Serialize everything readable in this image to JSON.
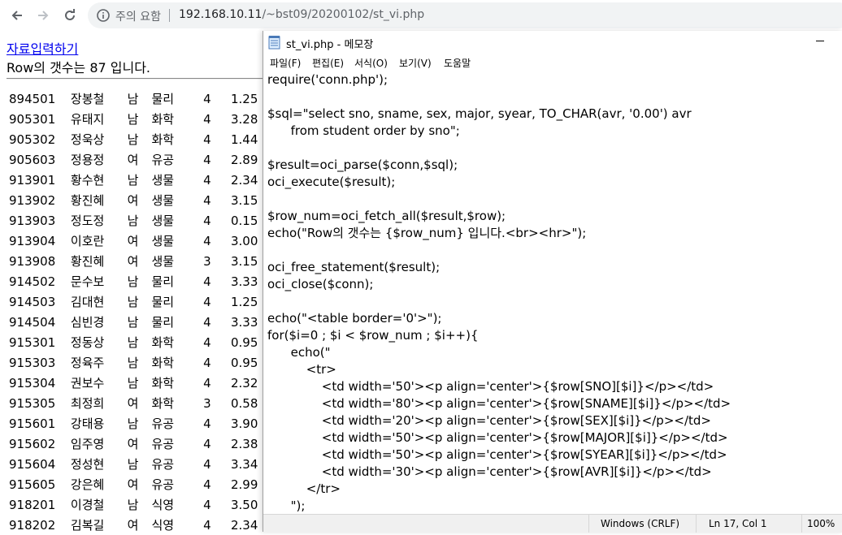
{
  "browser": {
    "security_label": "주의 요함",
    "url_host": "192.168.10.11",
    "url_path": "/~bst09/20200102/st_vi.php"
  },
  "page": {
    "link_text": "자료입력하기",
    "row_count_text": "Row의 갯수는 87 입니다.",
    "rows": [
      [
        "894501",
        "장봉철",
        "남",
        "물리",
        "4",
        "1.25"
      ],
      [
        "905301",
        "유태지",
        "남",
        "화학",
        "4",
        "3.28"
      ],
      [
        "905302",
        "정욱상",
        "남",
        "화학",
        "4",
        "1.44"
      ],
      [
        "905603",
        "정용정",
        "여",
        "유공",
        "4",
        "2.89"
      ],
      [
        "913901",
        "황수현",
        "남",
        "생물",
        "4",
        "2.34"
      ],
      [
        "913902",
        "황진혜",
        "여",
        "생물",
        "4",
        "3.15"
      ],
      [
        "913903",
        "정도정",
        "남",
        "생물",
        "4",
        "0.15"
      ],
      [
        "913904",
        "이호란",
        "여",
        "생물",
        "4",
        "3.00"
      ],
      [
        "913908",
        "황진혜",
        "여",
        "생물",
        "3",
        "3.15"
      ],
      [
        "914502",
        "문수보",
        "남",
        "물리",
        "4",
        "3.33"
      ],
      [
        "914503",
        "김대현",
        "남",
        "물리",
        "4",
        "1.25"
      ],
      [
        "914504",
        "심빈경",
        "남",
        "물리",
        "4",
        "3.33"
      ],
      [
        "915301",
        "정동상",
        "남",
        "화학",
        "4",
        "0.95"
      ],
      [
        "915303",
        "정육주",
        "남",
        "화학",
        "4",
        "0.95"
      ],
      [
        "915304",
        "권보수",
        "남",
        "화학",
        "4",
        "2.32"
      ],
      [
        "915305",
        "최정희",
        "여",
        "화학",
        "3",
        "0.58"
      ],
      [
        "915601",
        "강태용",
        "남",
        "유공",
        "4",
        "3.90"
      ],
      [
        "915602",
        "임주영",
        "여",
        "유공",
        "4",
        "2.38"
      ],
      [
        "915604",
        "정성현",
        "남",
        "유공",
        "4",
        "3.34"
      ],
      [
        "915605",
        "강은혜",
        "여",
        "유공",
        "4",
        "2.99"
      ],
      [
        "918201",
        "이경철",
        "남",
        "식영",
        "4",
        "3.50"
      ],
      [
        "918202",
        "김복길",
        "여",
        "식영",
        "4",
        "2.34"
      ]
    ]
  },
  "notepad": {
    "title": "st_vi.php - 메모장",
    "menu": [
      "파일(F)",
      "편집(E)",
      "서식(O)",
      "보기(V)",
      "도움말"
    ],
    "lines": [
      "require('conn.php');",
      "",
      "$sql=\"select sno, sname, sex, major, syear, TO_CHAR(avr, '0.00') avr",
      "\t  from student order by sno\";",
      "",
      "$result=oci_parse($conn,$sql);",
      "oci_execute($result);",
      "",
      "$row_num=oci_fetch_all($result,$row);",
      "echo(\"Row의 갯수는 {$row_num} 입니다.<br><hr>\");",
      "",
      "oci_free_statement($result);",
      "oci_close($conn);",
      "",
      "echo(\"<table border='0'>\");",
      "for($i=0 ; $i < $row_num ; $i++){",
      "\t  echo(\"",
      "\t\t  <tr>",
      "\t\t\t  <td width='50'><p align='center'>{$row[SNO][$i]}</p></td>",
      "\t\t\t  <td width='80'><p align='center'>{$row[SNAME][$i]}</p></td>",
      "\t\t\t  <td width='20'><p align='center'>{$row[SEX][$i]}</p></td>",
      "\t\t\t  <td width='50'><p align='center'>{$row[MAJOR][$i]}</p></td>",
      "\t\t\t  <td width='50'><p align='center'>{$row[SYEAR][$i]}</p></td>",
      "\t\t\t  <td width='30'><p align='center'>{$row[AVR][$i]}</p></td>",
      "\t\t  </tr>",
      "\t  \");"
    ],
    "status": {
      "line_ending": "Windows (CRLF)",
      "position": "Ln 17, Col 1",
      "zoom": "100%"
    }
  }
}
